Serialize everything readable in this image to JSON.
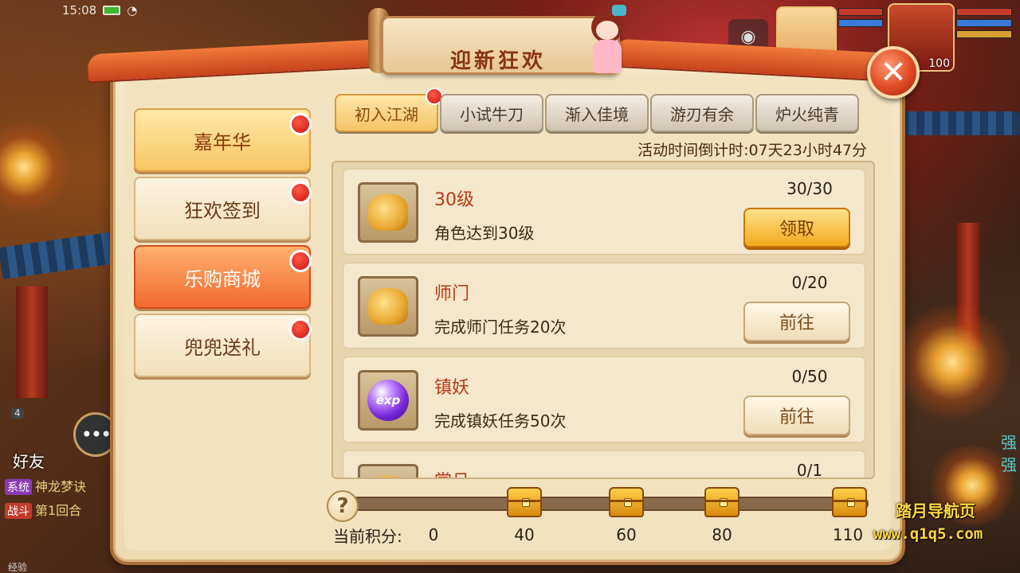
{
  "status": {
    "time": "15:08"
  },
  "dialog": {
    "title": "迎新狂欢",
    "close_label": "✕"
  },
  "menu": [
    {
      "label": "嘉年华",
      "style": "active"
    },
    {
      "label": "狂欢签到",
      "style": "normal"
    },
    {
      "label": "乐购商城",
      "style": "hot"
    },
    {
      "label": "兜兜送礼",
      "style": "normal"
    }
  ],
  "tabs": [
    {
      "label": "初入江湖",
      "active": true,
      "dot": true
    },
    {
      "label": "小试牛刀",
      "active": false,
      "dot": false
    },
    {
      "label": "渐入佳境",
      "active": false,
      "dot": false
    },
    {
      "label": "游刃有余",
      "active": false,
      "dot": false
    },
    {
      "label": "炉火纯青",
      "active": false,
      "dot": false
    }
  ],
  "countdown": {
    "label": "活动时间倒计时:",
    "value": "07天23小时47分"
  },
  "tasks": [
    {
      "name": "30级",
      "desc": "角色达到30级",
      "progress": "30/30",
      "button": "领取",
      "button_type": "claim",
      "icon": "gift-bag-icon"
    },
    {
      "name": "师门",
      "desc": "完成师门任务20次",
      "progress": "0/20",
      "button": "前往",
      "button_type": "go",
      "icon": "gift-bag-icon"
    },
    {
      "name": "镇妖",
      "desc": "完成镇妖任务50次",
      "progress": "0/50",
      "button": "前往",
      "button_type": "go",
      "icon": "exp-orb-icon",
      "icon_text": "exp"
    },
    {
      "name": "赏月",
      "desc": "",
      "progress": "0/1",
      "button": "",
      "button_type": "",
      "icon": "gift-bag-icon"
    }
  ],
  "score": {
    "label": "当前积分:",
    "current": "0",
    "milestones": [
      "40",
      "60",
      "80",
      "110"
    ]
  },
  "hud": {
    "friend_label": "好友",
    "friend_count": "4",
    "chat_icon": "•••",
    "chat": [
      {
        "tag": "系统",
        "text": "神龙梦诀"
      },
      {
        "tag": "战斗",
        "text": "第1回合"
      }
    ],
    "exp_label": "经验",
    "pet_level": "100",
    "side_chars": [
      "强",
      "强"
    ]
  },
  "watermark": {
    "line1": "踏月导航页",
    "line2": "www.q1q5.com"
  },
  "colors": {
    "accent": "#f4c468",
    "title": "#8a3412",
    "task_name": "#b83a16"
  }
}
